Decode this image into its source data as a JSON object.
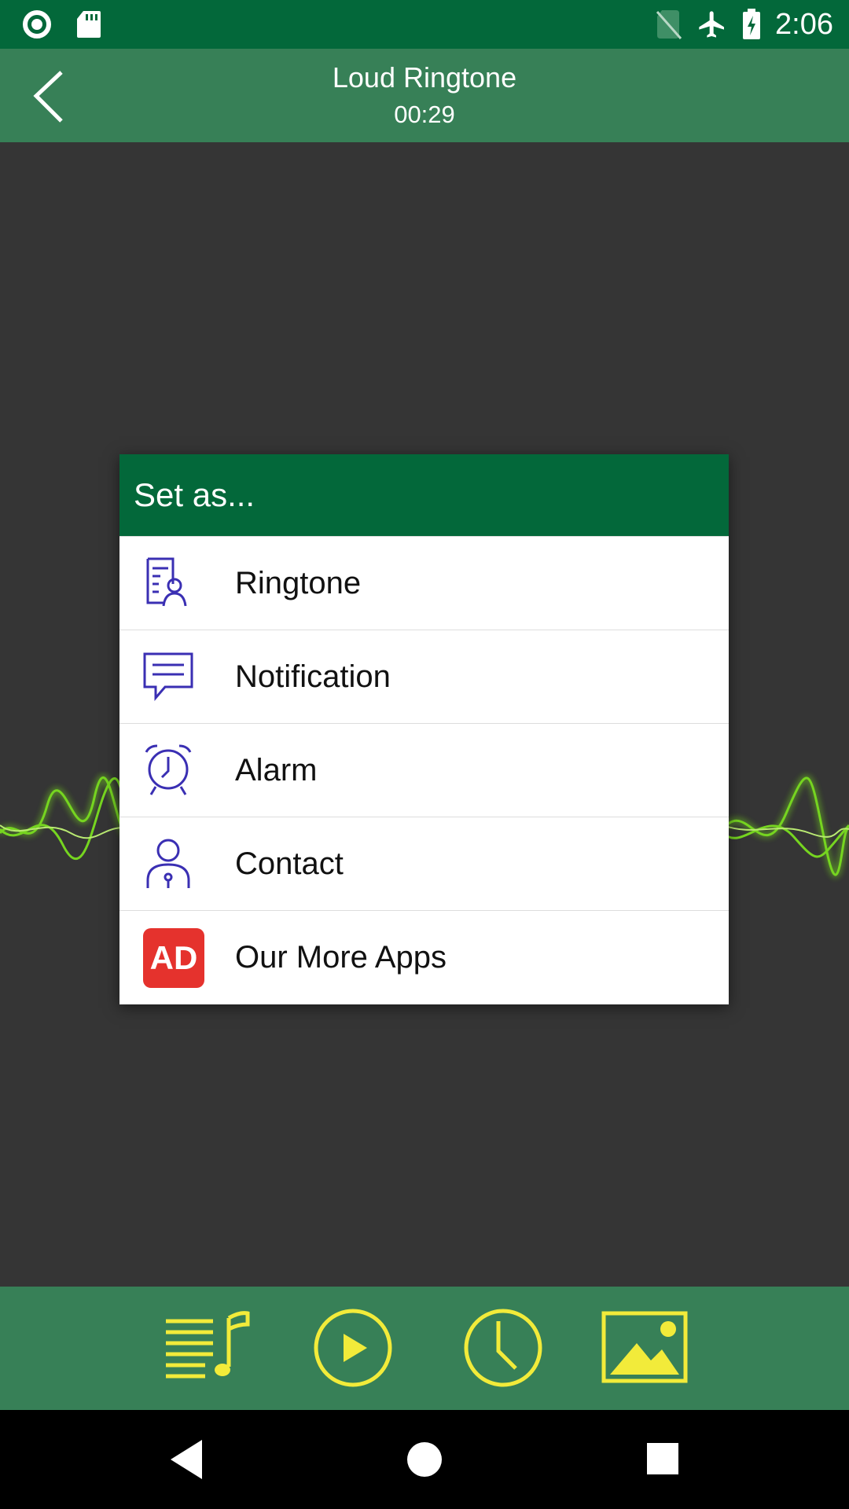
{
  "status_bar": {
    "time": "2:06",
    "icons": [
      "record-icon",
      "sd-card-icon",
      "no-sim-icon",
      "airplane-mode-icon",
      "battery-charging-icon"
    ]
  },
  "app_bar": {
    "title": "Loud Ringtone",
    "duration": "00:29",
    "back_icon": "chevron-left-icon"
  },
  "dialog": {
    "title": "Set as...",
    "items": [
      {
        "label": "Ringtone",
        "icon": "ringtone-contact-card-icon"
      },
      {
        "label": "Notification",
        "icon": "chat-bubble-icon"
      },
      {
        "label": "Alarm",
        "icon": "alarm-clock-icon"
      },
      {
        "label": "Contact",
        "icon": "contact-person-icon"
      },
      {
        "label": "Our More Apps",
        "icon": "ad-badge-icon",
        "badge_text": "AD"
      }
    ]
  },
  "toolbar": {
    "items": [
      "playlist-music-icon",
      "play-circle-icon",
      "clock-icon",
      "image-icon"
    ]
  },
  "nav": {
    "items": [
      "back-triangle-icon",
      "home-circle-icon",
      "recents-square-icon"
    ]
  },
  "colors": {
    "status_bar": "#03683a",
    "app_bar": "#378057",
    "background": "#353535",
    "dialog_header": "#03683a",
    "menu_icon": "#3a2fb3",
    "toolbar_icon": "#f2eb3a",
    "ad_badge": "#e5322d",
    "waveform": "#7ee81f"
  }
}
